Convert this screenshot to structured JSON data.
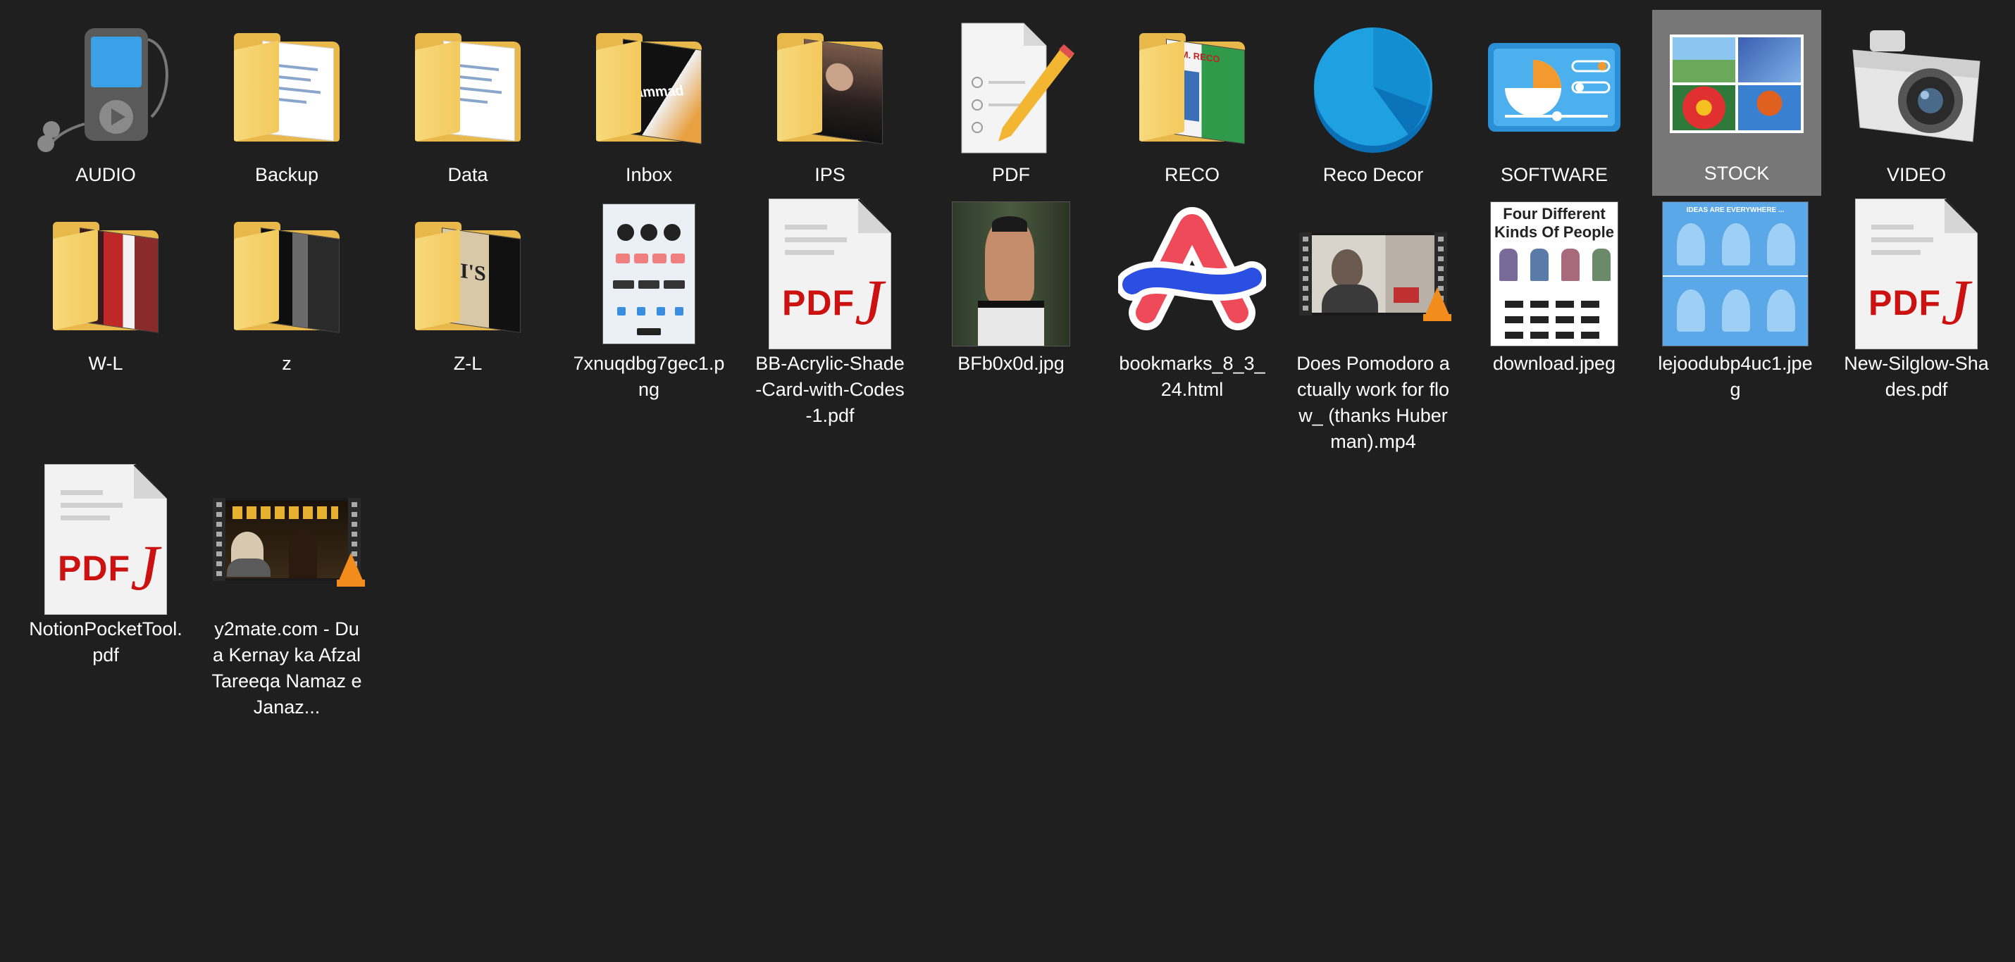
{
  "desktop": {
    "items": [
      {
        "name": "AUDIO",
        "type": "icon",
        "icon": "audio-player-icon"
      },
      {
        "name": "Backup",
        "type": "folder",
        "icon": "folder-icon"
      },
      {
        "name": "Data",
        "type": "folder",
        "icon": "folder-icon"
      },
      {
        "name": "Inbox",
        "type": "folder-photo",
        "icon": "folder-icon",
        "thumb_text": "ammad"
      },
      {
        "name": "IPS",
        "type": "folder-photo",
        "icon": "folder-icon"
      },
      {
        "name": "PDF",
        "type": "icon",
        "icon": "document-pencil-icon"
      },
      {
        "name": "RECO",
        "type": "folder-photo",
        "icon": "folder-icon",
        "thumb_text": "G.M. RECO"
      },
      {
        "name": "Reco Decor",
        "type": "icon",
        "icon": "pie-chart-icon"
      },
      {
        "name": "SOFTWARE",
        "type": "icon",
        "icon": "control-panel-icon"
      },
      {
        "name": "STOCK",
        "type": "icon",
        "icon": "picture-collage-icon",
        "selected": true
      },
      {
        "name": "VIDEO",
        "type": "icon",
        "icon": "camera-icon"
      },
      {
        "name": "W-L",
        "type": "folder-photo",
        "icon": "folder-icon"
      },
      {
        "name": "z",
        "type": "folder-photo",
        "icon": "folder-icon"
      },
      {
        "name": "Z-L",
        "type": "folder-photo",
        "icon": "folder-icon",
        "thumb_text": "JI'S"
      },
      {
        "name": "7xnuqdbg7gec1.png",
        "type": "image",
        "icon": "flowchart-image-icon"
      },
      {
        "name": "BB-Acrylic-Shade-Card-with-Codes-1.pdf",
        "type": "pdf",
        "icon": "pdf-file-icon"
      },
      {
        "name": "BFb0x0d.jpg",
        "type": "image",
        "icon": "fighter-image-icon"
      },
      {
        "name": "bookmarks_8_3_24.html",
        "type": "icon",
        "icon": "arc-browser-icon"
      },
      {
        "name": "Does Pomodoro actually work for flow_ (thanks Huberman).mp4",
        "type": "video",
        "icon": "video-file-icon"
      },
      {
        "name": "download.jpeg",
        "type": "image",
        "icon": "infographic-image-icon",
        "thumb_title": "Four Different Kinds Of People"
      },
      {
        "name": "lejoodubp4uc1.jpeg",
        "type": "image",
        "icon": "infographic-image-icon",
        "thumb_title": "IDEAS ARE EVERYWHERE ..."
      },
      {
        "name": "New-Silglow-Shades.pdf",
        "type": "pdf",
        "icon": "pdf-file-icon"
      },
      {
        "name": "NotionPocketTool.pdf",
        "type": "pdf",
        "icon": "pdf-file-icon"
      },
      {
        "name": "y2mate.com - Dua Kernay ka Afzal Tareeqa Namaz e Janaz...",
        "type": "video",
        "icon": "video-file-icon"
      }
    ],
    "pdf_label": "PDF",
    "colors": {
      "background": "#1f1f1f",
      "selection": "#777777",
      "folder": "#e8b84a",
      "pdf_red": "#cc1111",
      "vlc_orange": "#f28c1c"
    }
  }
}
